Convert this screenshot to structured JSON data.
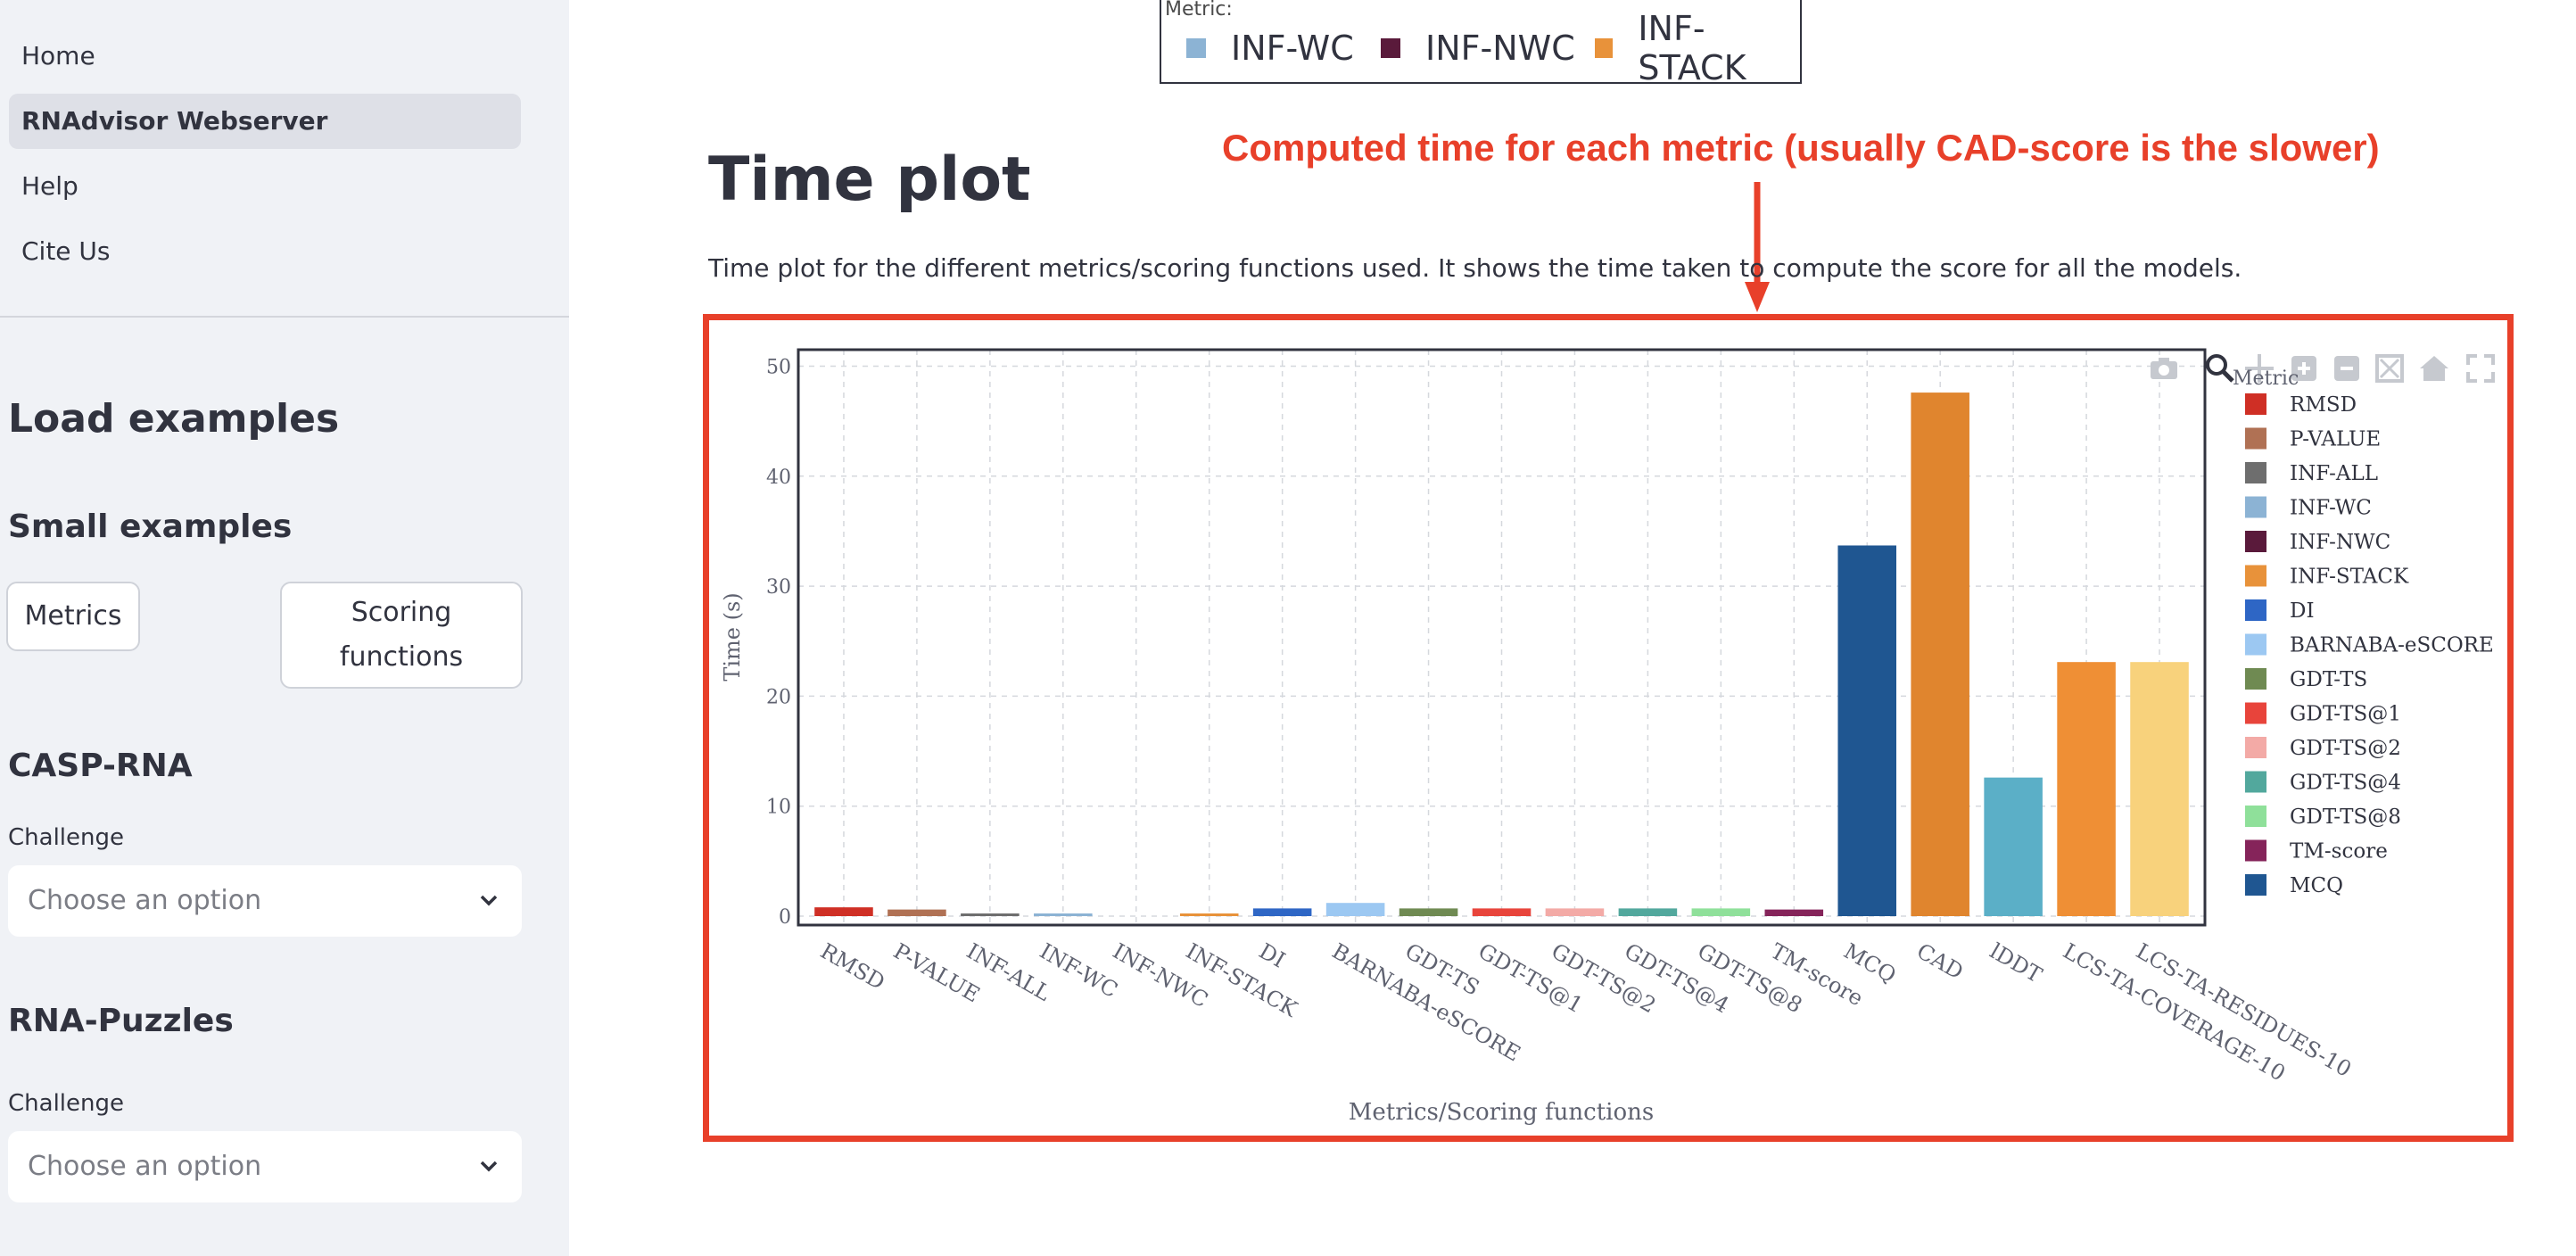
{
  "sidebar": {
    "nav": [
      {
        "label": "Home",
        "active": false
      },
      {
        "label": "RNAdvisor Webserver",
        "active": true
      },
      {
        "label": "Help",
        "active": false
      },
      {
        "label": "Cite Us",
        "active": false
      }
    ],
    "load_examples": "Load examples",
    "small_examples": "Small examples",
    "metrics_button": "Metrics",
    "scoring_button": "Scoring functions",
    "casp": {
      "title": "CASP-RNA",
      "label": "Challenge",
      "placeholder": "Choose an option"
    },
    "puzzles": {
      "title": "RNA-Puzzles",
      "label": "Challenge",
      "placeholder": "Choose an option"
    }
  },
  "top_legend": {
    "title": "Metric:",
    "items": [
      {
        "label": "INF-WC",
        "color": "#8cb3d4"
      },
      {
        "label": "INF-NWC",
        "color": "#5a1a3b"
      },
      {
        "label": "INF-STACK",
        "color": "#e8923a"
      }
    ]
  },
  "annotation": "Computed time for each metric (usually CAD-score is the slower)",
  "main": {
    "title": "Time plot",
    "description": "Time plot for the different metrics/scoring functions used. It shows the time taken to compute the score for all the models."
  },
  "chart_data": {
    "type": "bar",
    "xlabel": "Metrics/Scoring functions",
    "ylabel": "Time (s)",
    "ylim": [
      0,
      50
    ],
    "yticks": [
      0,
      10,
      20,
      30,
      40,
      50
    ],
    "grid": true,
    "legend_title": "Metric",
    "legend_placement": "right",
    "categories": [
      "RMSD",
      "P-VALUE",
      "INF-ALL",
      "INF-WC",
      "INF-NWC",
      "INF-STACK",
      "DI",
      "BARNABA-eSCORE",
      "GDT-TS",
      "GDT-TS@1",
      "GDT-TS@2",
      "GDT-TS@4",
      "GDT-TS@8",
      "TM-score",
      "MCQ",
      "CAD",
      "lDDT",
      "LCS-TA-COVERAGE-10",
      "LCS-TA-RESIDUES-10"
    ],
    "values": [
      0.8,
      0.6,
      0.2,
      0.2,
      0.0,
      0.2,
      0.7,
      1.2,
      0.7,
      0.7,
      0.7,
      0.7,
      0.7,
      0.6,
      33.7,
      47.6,
      12.6,
      23.1,
      23.1
    ],
    "colors": [
      "#cf2f25",
      "#b07154",
      "#6e6e6e",
      "#8cb3d4",
      "#5a1a3b",
      "#e8923a",
      "#2e66c5",
      "#9cc8f2",
      "#6f8a52",
      "#e8443b",
      "#f3aaa6",
      "#52a89d",
      "#8fe09a",
      "#85245a",
      "#1f5691",
      "#e0852e",
      "#5bafc7",
      "#ef8f35",
      "#f8d27c"
    ],
    "legend": [
      "RMSD",
      "P-VALUE",
      "INF-ALL",
      "INF-WC",
      "INF-NWC",
      "INF-STACK",
      "DI",
      "BARNABA-eSCORE",
      "GDT-TS",
      "GDT-TS@1",
      "GDT-TS@2",
      "GDT-TS@4",
      "GDT-TS@8",
      "TM-score",
      "MCQ"
    ]
  }
}
